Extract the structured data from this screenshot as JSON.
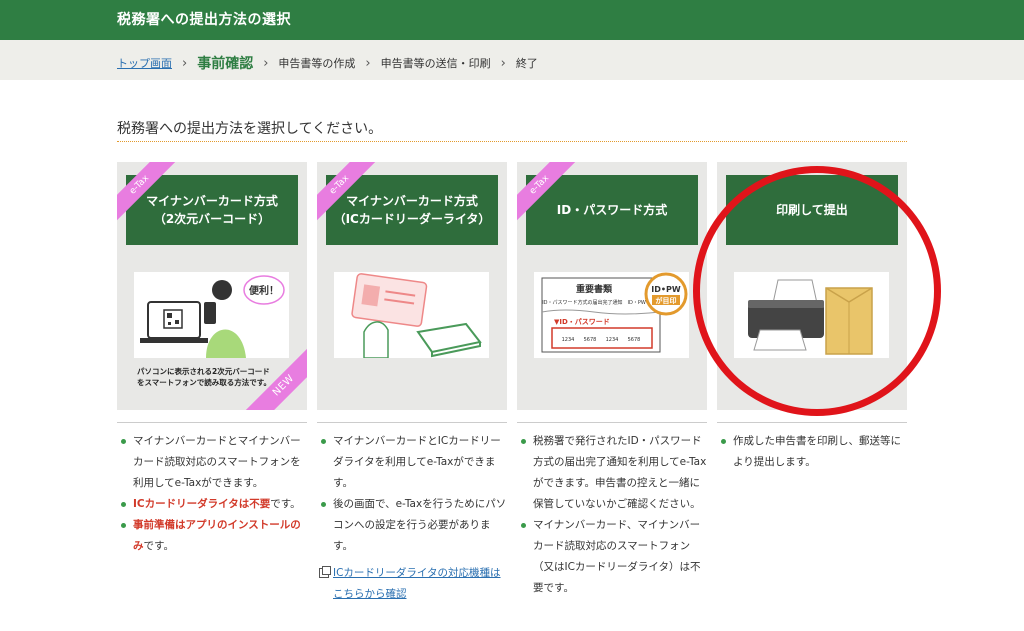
{
  "header": {
    "title": "税務署への提出方法の選択"
  },
  "breadcrumb": {
    "home": "トップ画面",
    "current": "事前確認",
    "step3": "申告書等の作成",
    "step4": "申告書等の送信・印刷",
    "step5": "終了",
    "sep": "›"
  },
  "intro": "税務署への提出方法を選択してください。",
  "cards": [
    {
      "tag": "e-Tax",
      "title": "マイナンバーカード方式\n（2次元バーコード）",
      "caption": "パソコンに表示される2次元バーコード\nをスマートフォンで読み取る方法です。",
      "badge": "NEW",
      "bubble": "便利！"
    },
    {
      "tag": "e-Tax",
      "title": "マイナンバーカード方式\n（ICカードリーダーライタ）"
    },
    {
      "tag": "e-Tax",
      "title": "ID・パスワード方式",
      "doc_title": "重要書類",
      "doc_sub": "ID・パスワード方式の届出完了通知　ID・PW",
      "stamp_line1": "ID•PW",
      "stamp_line2": "が目印",
      "id_label": "▼ID・パスワード",
      "id_digits": [
        "1234",
        "5678",
        "1234",
        "5678"
      ]
    },
    {
      "title": "印刷して提出"
    }
  ],
  "descriptions": {
    "col1": {
      "item1": "マイナンバーカードとマイナンバーカード読取対応のスマートフォンを利用してe-Taxができます。",
      "item2_red": "ICカードリーダライタは不要",
      "item2_rest": "です。",
      "item3_red": "事前準備はアプリのインストールのみ",
      "item3_rest": "です。"
    },
    "col2": {
      "item1": "マイナンバーカードとICカードリーダライタを利用してe-Taxができます。",
      "item2": "後の画面で、e-Taxを行うためにパソコンへの設定を行う必要があります。",
      "link": "ICカードリーダライタの対応機種はこちらから確認"
    },
    "col3": {
      "item1": "税務署で発行されたID・パスワード方式の届出完了通知を利用してe-Taxができます。申告書の控えと一緒に保管していないかご確認ください。",
      "item2": "マイナンバーカード、マイナンバーカード読取対応のスマートフォン（又はICカードリーダライタ）は不要です。"
    },
    "col4": {
      "item1": "作成した申告書を印刷し、郵送等により提出します。"
    }
  },
  "colors": {
    "header_green": "#2f7e43",
    "card_green": "#2f6d3c",
    "etax_pink": "#e87de0",
    "alert_red": "#d23a2a",
    "link_blue": "#2a6fb0",
    "circle_red": "#e0141a"
  }
}
